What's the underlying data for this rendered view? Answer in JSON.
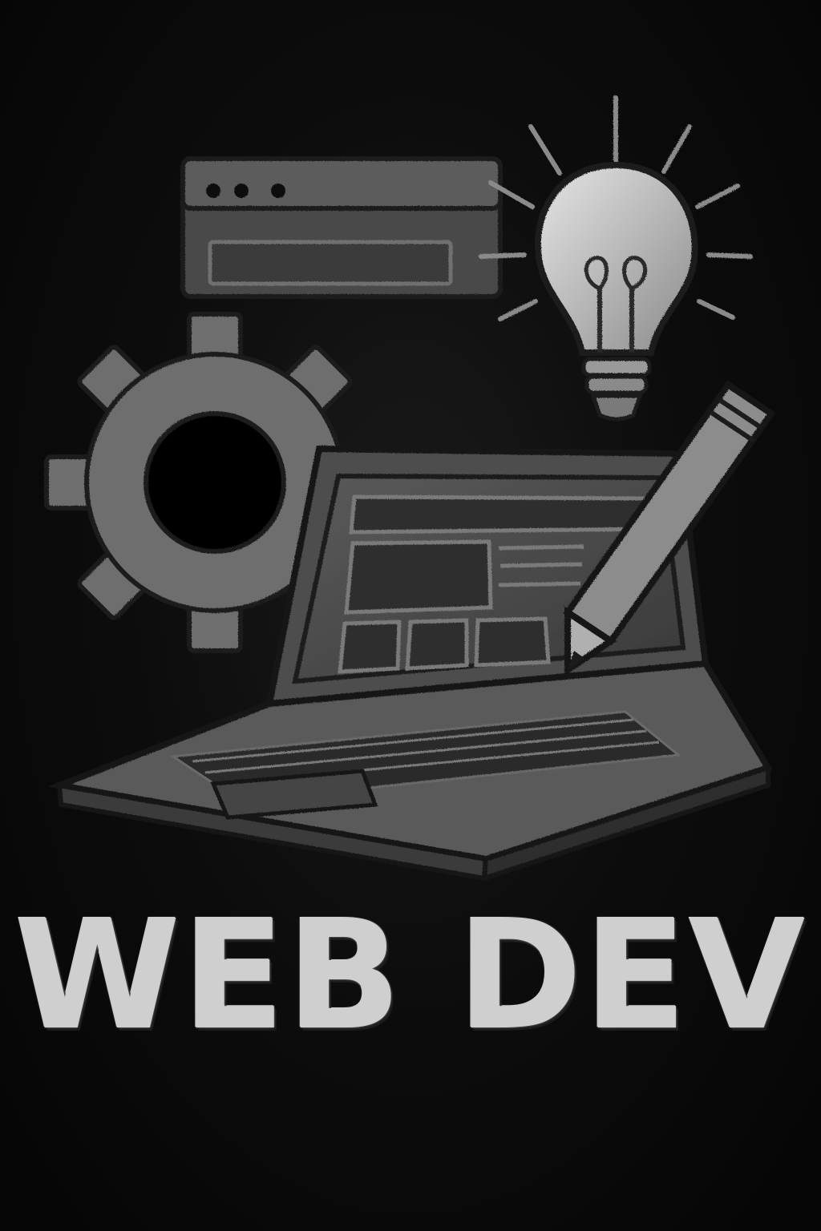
{
  "poster": {
    "title": "WEB DEV"
  },
  "icons": {
    "browser_window": "browser-window-icon",
    "light_bulb": "light-bulb-icon",
    "gear": "gear-icon",
    "laptop": "laptop-icon",
    "pencil": "pencil-icon"
  },
  "colors": {
    "background": "#070707",
    "chalk_light": "#cfcfcf",
    "chalk_mid": "#7a7a7a",
    "chalk_dark": "#3a3a3a"
  }
}
